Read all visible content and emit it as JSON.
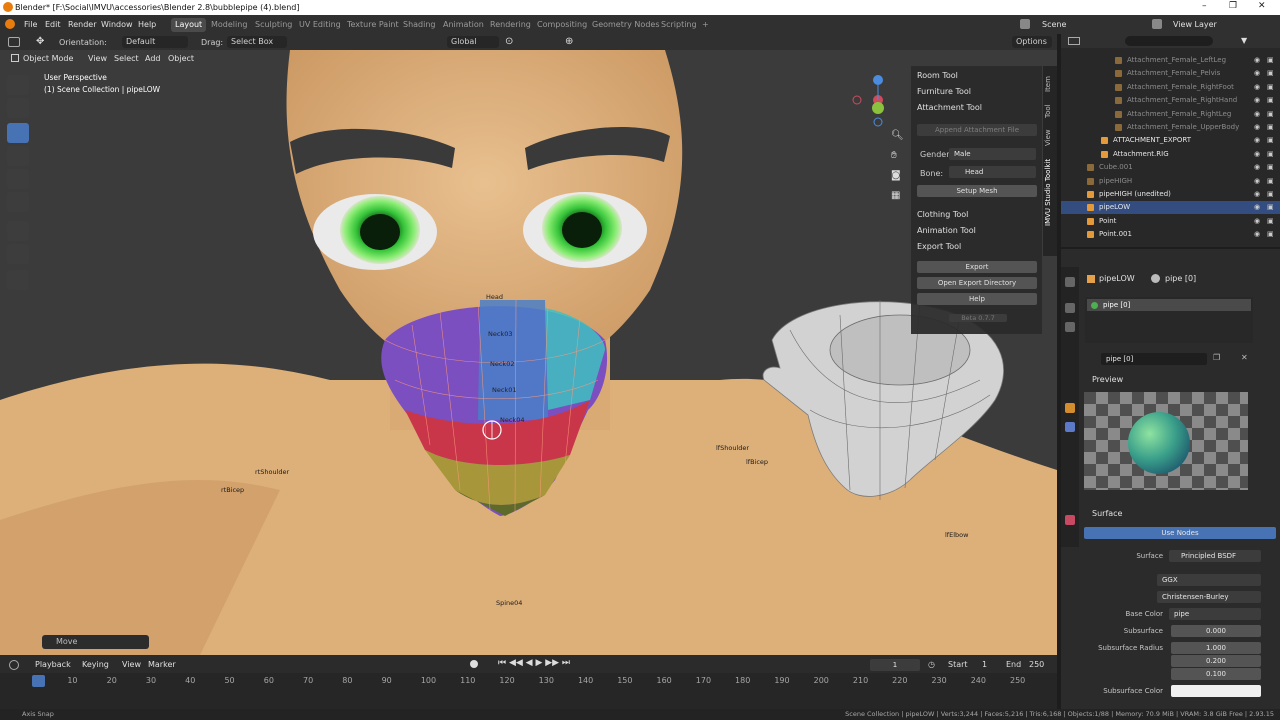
{
  "window": {
    "title": "Blender* [F:\\Social\\IMVU\\accessories\\Blender 2.8\\bubblepipe (4).blend]",
    "controls": [
      "–",
      "❐",
      "✕"
    ]
  },
  "menu": {
    "items": [
      "File",
      "Edit",
      "Render",
      "Window",
      "Help"
    ],
    "workspaces": [
      "Layout",
      "Modeling",
      "Sculpting",
      "UV Editing",
      "Texture Paint",
      "Shading",
      "Animation",
      "Rendering",
      "Compositing",
      "Geometry Nodes",
      "Scripting"
    ],
    "active_workspace": "Layout",
    "add_tab": "+",
    "scene_label": "Scene",
    "view_layer_label": "View Layer"
  },
  "viewport_header": {
    "orientation_label": "Orientation:",
    "orientation_value": "Default",
    "drag_label": "Drag:",
    "drag_value": "Select Box",
    "transform_value": "Global",
    "options_label": "Options",
    "mode": "Object Mode",
    "menus": [
      "View",
      "Select",
      "Add",
      "Object"
    ]
  },
  "viewport": {
    "perspective": "User Perspective",
    "collection": "(1) Scene Collection | pipeLOW",
    "bone_labels": [
      "rtShoulder",
      "rtBicep",
      "lfShoulder",
      "lfBicep",
      "lfElbow",
      "Spine04",
      "Head",
      "Neck03",
      "Neck02",
      "Neck01",
      "Neck04"
    ],
    "operator_panel": "Move"
  },
  "npanel": {
    "sections": {
      "room": "Room Tool",
      "furniture": "Furniture Tool",
      "attachment": "Attachment Tool",
      "clothing": "Clothing Tool",
      "animation": "Animation Tool",
      "export": "Export Tool"
    },
    "append_button": "Append Attachment File",
    "gender_label": "Gender:",
    "gender_value": "Male",
    "bone_label": "Bone:",
    "bone_value": "Head",
    "setup_mesh": "Setup Mesh",
    "export_button": "Export",
    "open_dir_button": "Open Export Directory",
    "help_button": "Help",
    "version": "Beta 0.7.7",
    "tabs": [
      "Item",
      "Tool",
      "View",
      "IMVU Studio Toolkit"
    ]
  },
  "outliner": {
    "rows": [
      {
        "name": "Attachment_Female_LeftLeg",
        "dim": true,
        "selected": false
      },
      {
        "name": "Attachment_Female_Pelvis",
        "dim": true,
        "selected": false
      },
      {
        "name": "Attachment_Female_RightFoot",
        "dim": true,
        "selected": false
      },
      {
        "name": "Attachment_Female_RightHand",
        "dim": true,
        "selected": false
      },
      {
        "name": "Attachment_Female_RightLeg",
        "dim": true,
        "selected": false
      },
      {
        "name": "Attachment_Female_UpperBody",
        "dim": true,
        "selected": false
      },
      {
        "name": "ATTACHMENT_EXPORT",
        "dim": false,
        "selected": false
      },
      {
        "name": "Attachment.RIG",
        "dim": false,
        "selected": false
      },
      {
        "name": "Cube.001",
        "dim": true,
        "selected": false
      },
      {
        "name": "pipeHIGH",
        "dim": true,
        "selected": false
      },
      {
        "name": "pipeHIGH (unedited)",
        "dim": false,
        "selected": false
      },
      {
        "name": "pipeLOW",
        "dim": false,
        "selected": true
      },
      {
        "name": "Point",
        "dim": false,
        "selected": false
      },
      {
        "name": "Point.001",
        "dim": false,
        "selected": false
      }
    ]
  },
  "properties": {
    "object_name": "pipeLOW",
    "material_slot_header": "pipe [0]",
    "slot_item": "pipe [0]",
    "material_field": "pipe [0]",
    "preview_label": "Preview",
    "surface_label": "Surface",
    "use_nodes": "Use Nodes",
    "surface_field_label": "Surface",
    "surface_value": "Principled BSDF",
    "distribution": "GGX",
    "subsurface_method": "Christensen-Burley",
    "base_color_label": "Base Color",
    "base_color_value": "pipe",
    "subsurface_label": "Subsurface",
    "subsurface_value": "0.000",
    "subsurface_radius_label": "Subsurface Radius",
    "subsurface_radius": [
      "1.000",
      "0.200",
      "0.100"
    ],
    "subsurface_color_label": "Subsurface Color"
  },
  "timeline": {
    "menus": [
      "Playback",
      "Keying",
      "View",
      "Marker"
    ],
    "current_frame": "1",
    "start_label": "Start",
    "start_value": "1",
    "end_label": "End",
    "end_value": "250",
    "ruler": [
      "1",
      "10",
      "20",
      "30",
      "40",
      "50",
      "60",
      "70",
      "80",
      "90",
      "100",
      "110",
      "120",
      "130",
      "140",
      "150",
      "160",
      "170",
      "180",
      "190",
      "200",
      "210",
      "220",
      "230",
      "240",
      "250"
    ]
  },
  "statusbar": {
    "left": "Axis Snap",
    "right": "Scene Collection | pipeLOW | Verts:3,244 | Faces:5,216 | Tris:6,168 | Objects:1/88 | Memory: 70.9 MiB | VRAM: 3.8 GiB Free | 2.93.15"
  },
  "colors": {
    "accent": "#4772b3",
    "selected_row": "#334d80",
    "skin": "#e2b887",
    "eye_green": "#36c43a"
  }
}
